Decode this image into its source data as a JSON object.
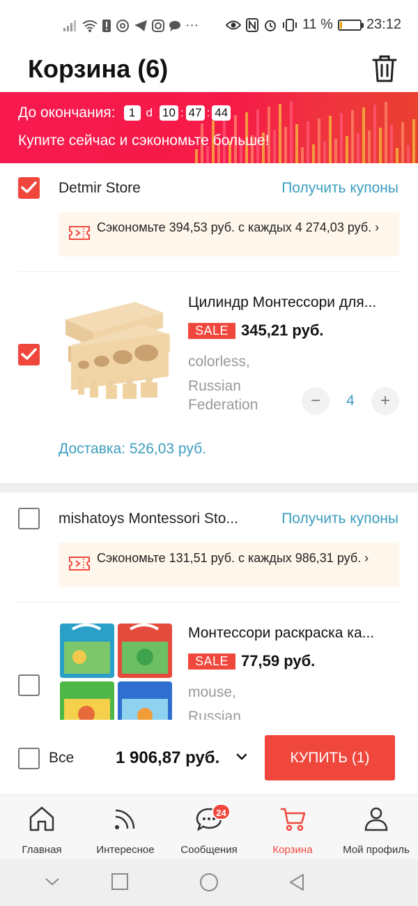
{
  "status_bar": {
    "battery_pct": "11 %",
    "battery_level": 0.11,
    "time": "23:12"
  },
  "header": {
    "title": "Корзина (6)"
  },
  "promo": {
    "prefix": "До окончания:",
    "days": "1",
    "days_unit": "d",
    "hours": "10",
    "minutes": "47",
    "seconds": "44",
    "subtitle": "Купите сейчас и сэкономьте больше!"
  },
  "stores": [
    {
      "name": "Detmir Store",
      "checked": true,
      "coupons_label": "Получить купоны",
      "coupon_text": "Сэкономьте 394,53 руб. с каждых 4 274,03 руб. ›",
      "product": {
        "title": "Цилиндр Монтессори для...",
        "sale": "SALE",
        "price": "345,21 руб.",
        "variant1": "colorless,",
        "variant2": "Russian",
        "variant3": "Federation",
        "qty": "4",
        "checked": true
      },
      "delivery": "Доставка: 526,03 руб."
    },
    {
      "name": "mishatoys Montessori Sto...",
      "checked": false,
      "coupons_label": "Получить купоны",
      "coupon_text": "Сэкономьте 131,51 руб. с каждых 986,31 руб. ›",
      "product": {
        "title": "Монтессори раскраска ка...",
        "sale": "SALE",
        "price": "77,59 руб.",
        "variant1": "mouse,",
        "variant2": "Russian",
        "checked": false
      }
    }
  ],
  "checkout": {
    "all_label": "Все",
    "total": "1 906,87 руб.",
    "buy_label": "КУПИТЬ (1)"
  },
  "tabs": [
    {
      "label": "Главная",
      "icon": "home-icon"
    },
    {
      "label": "Интересное",
      "icon": "feed-icon"
    },
    {
      "label": "Сообщения",
      "icon": "messages-icon",
      "badge": "24"
    },
    {
      "label": "Корзина",
      "icon": "cart-icon",
      "active": true
    },
    {
      "label": "Мой профиль",
      "icon": "profile-icon"
    }
  ],
  "colors": {
    "accent": "#f0473d",
    "link": "#3c9dbf",
    "promo": "#f51b47"
  }
}
